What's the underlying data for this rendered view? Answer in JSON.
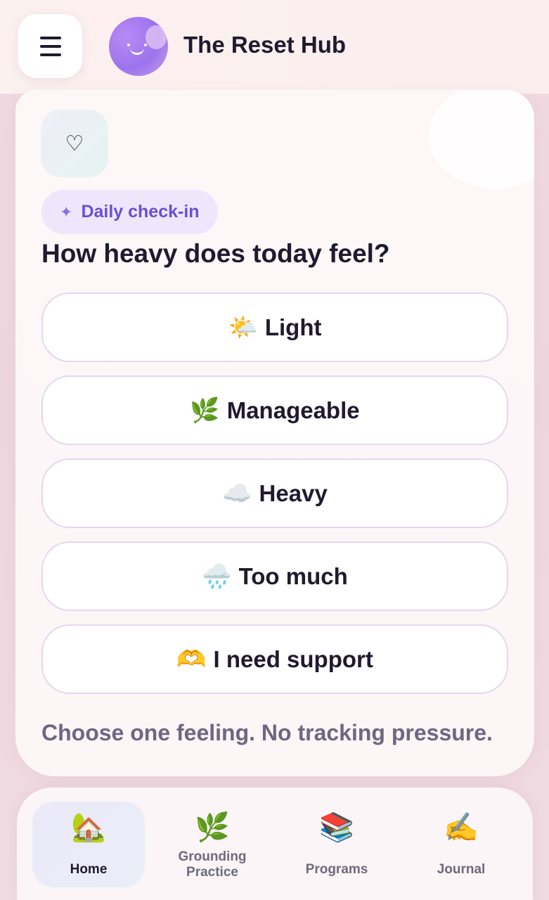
{
  "header": {
    "title": "The Reset Hub",
    "menu_icon": "hamburger-icon",
    "logo_icon": "smiley-orb-icon"
  },
  "checkin": {
    "heart_icon": "♡",
    "badge_label": "Daily check-in",
    "badge_icon": "✦",
    "question": "How heavy does today feel?",
    "options": [
      {
        "emoji": "🌤️",
        "label": "Light"
      },
      {
        "emoji": "🌿",
        "label": "Manageable"
      },
      {
        "emoji": "☁️",
        "label": "Heavy"
      },
      {
        "emoji": "🌧️",
        "label": "Too much"
      },
      {
        "emoji": "🫶",
        "label": "I need support"
      }
    ],
    "footnote": "Choose one feeling. No tracking pressure."
  },
  "nav": {
    "items": [
      {
        "icon": "🏡",
        "label": "Home",
        "active": true
      },
      {
        "icon": "🌿",
        "label": "Grounding Practice",
        "active": false
      },
      {
        "icon": "📚",
        "label": "Programs",
        "active": false
      },
      {
        "icon": "✍️",
        "label": "Journal",
        "active": false
      }
    ]
  },
  "colors": {
    "accent": "#6c4fd4",
    "text": "#1f1a2e",
    "muted": "#6e6780",
    "badge_bg": "#efe6fb",
    "option_border": "#e3d8ec"
  }
}
